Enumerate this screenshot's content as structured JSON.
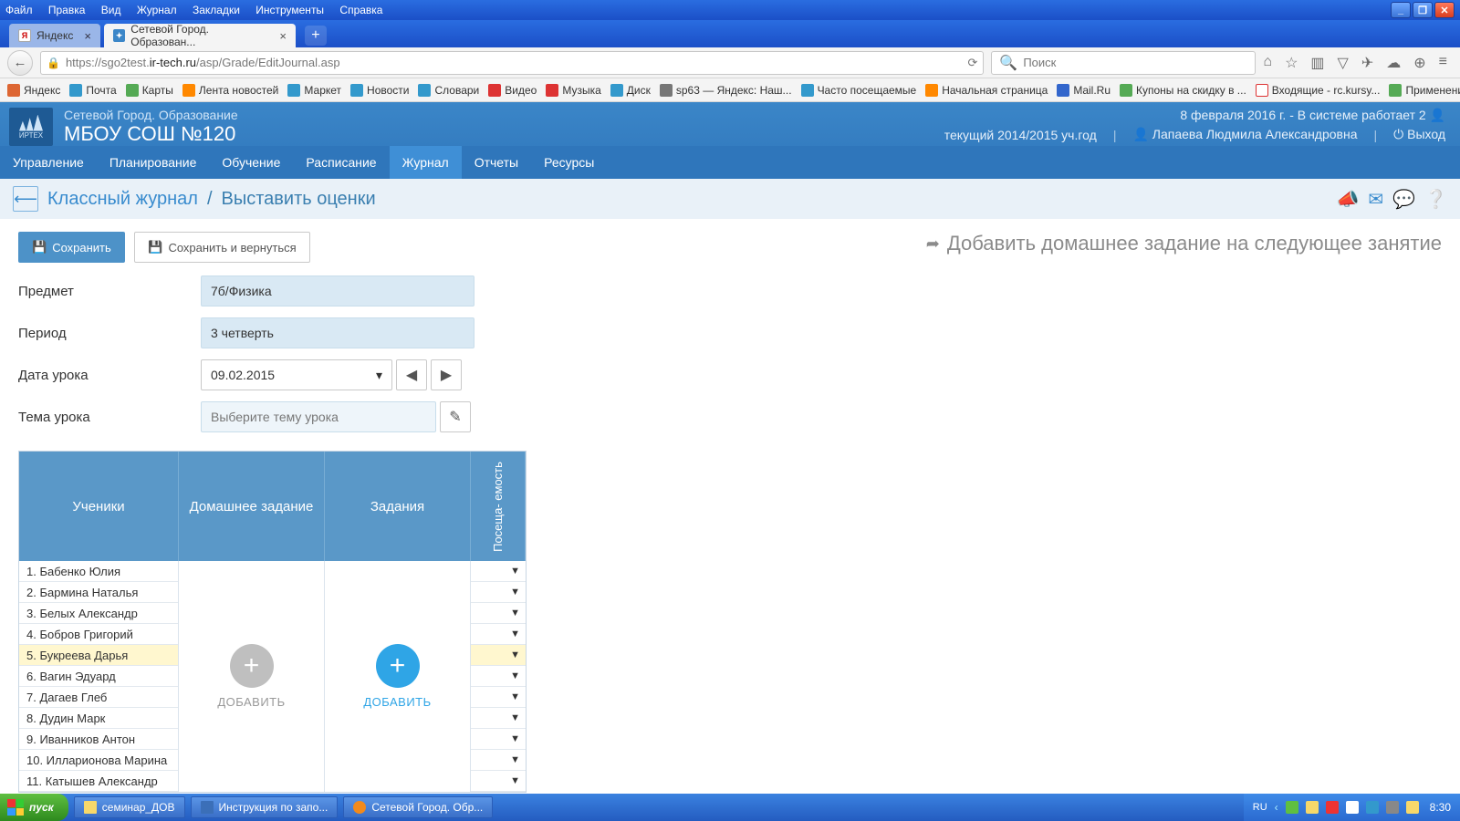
{
  "win": {
    "menus": [
      "Файл",
      "Правка",
      "Вид",
      "Журнал",
      "Закладки",
      "Инструменты",
      "Справка"
    ]
  },
  "tabs": {
    "t0": {
      "label": "Яндекс"
    },
    "t1": {
      "label": "Сетевой Город. Образован..."
    }
  },
  "url": {
    "prefix": "https://sgo2test.",
    "host": "ir-tech.ru",
    "suffix": "/asp/Grade/EditJournal.asp"
  },
  "search": {
    "placeholder": "Поиск"
  },
  "bookmarks": [
    "Яндекс",
    "Почта",
    "Карты",
    "Лента новостей",
    "Маркет",
    "Новости",
    "Словари",
    "Видео",
    "Музыка",
    "Диск",
    "sp63 — Яндекс: Наш...",
    "Часто посещаемые",
    "Начальная страница",
    "Mail.Ru",
    "Купоны на скидку в ...",
    "Входящие - rc.kursy...",
    "Применение Excel"
  ],
  "app": {
    "logo": "ИРТЕХ",
    "line1": "Сетевой Город. Образование",
    "line2": "МБОУ СОШ №120",
    "date": "8 февраля 2016 г. - В системе работает 2",
    "year": "текущий 2014/2015 уч.год",
    "user": "Лапаева Людмила Александровна",
    "exit": "Выход"
  },
  "nav": {
    "items": [
      "Управление",
      "Планирование",
      "Обучение",
      "Расписание",
      "Журнал",
      "Отчеты",
      "Ресурсы"
    ]
  },
  "crumb": {
    "a": "Классный журнал",
    "b": "Выставить оценки"
  },
  "buttons": {
    "save": "Сохранить",
    "saveback": "Сохранить и вернуться"
  },
  "addhw": "Добавить домашнее задание на следующее занятие",
  "form": {
    "subject_label": "Предмет",
    "subject": "7б/Физика",
    "period_label": "Период",
    "period": "3 четверть",
    "date_label": "Дата урока",
    "date": "09.02.2015",
    "theme_label": "Тема урока",
    "theme": "Выберите тему урока"
  },
  "table": {
    "h1": "Ученики",
    "h2": "Домашнее задание",
    "h3": "Задания",
    "h4": "Посеща-\nемость",
    "add": "ДОБАВИТЬ"
  },
  "students": [
    "1. Бабенко Юлия",
    "2. Бармина Наталья",
    "3. Белых Александр",
    "4. Бобров Григорий",
    "5. Букреева Дарья",
    "6. Вагин Эдуард",
    "7. Дагаев Глеб",
    "8. Дудин Марк",
    "9. Иванников Антон",
    "10. Илларионова Марина",
    "11. Катышев Александр"
  ],
  "highlight_index": 4,
  "taskbar": {
    "start": "пуск",
    "b0": "семинар_ДОВ",
    "b1": "Инструкция по запо...",
    "b2": "Сетевой Город. Обр...",
    "lang": "RU",
    "clock": "8:30"
  }
}
